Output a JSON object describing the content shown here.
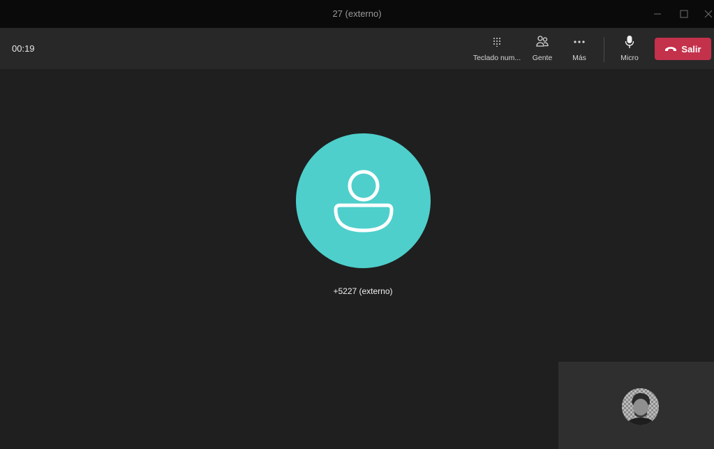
{
  "window": {
    "title": "27 (externo)"
  },
  "toolbar": {
    "timer": "00:19",
    "dialpad_label": "Teclado num...",
    "people_label": "Gente",
    "more_label": "Más",
    "mic_label": "Micro",
    "leave_label": "Salir"
  },
  "call": {
    "caller": "+5227 (externo)"
  },
  "colors": {
    "avatar_bg": "#4ecfcb",
    "hangup_bg": "#c4314b",
    "background": "#1f1f1f"
  }
}
